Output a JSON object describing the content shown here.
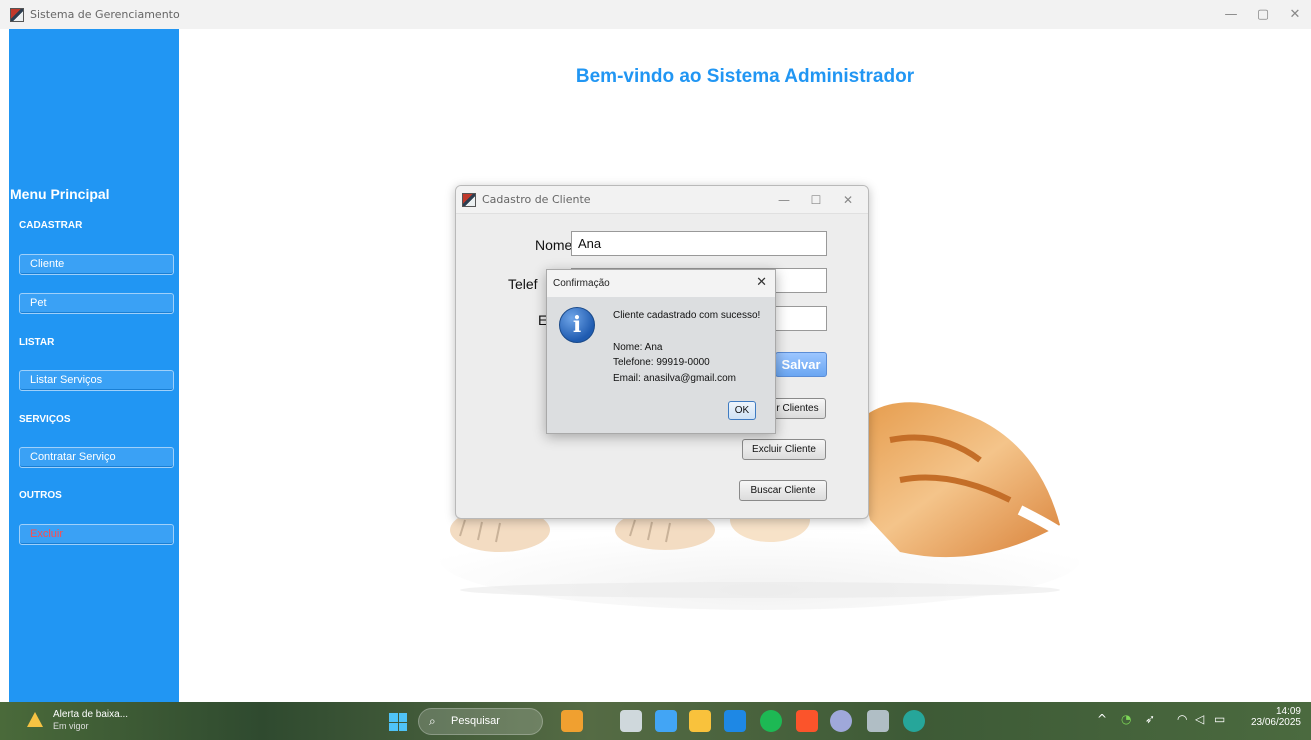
{
  "window": {
    "title": "Sistema de Gerenciamento",
    "minimize": "—",
    "maximize": "▢",
    "close": "✕"
  },
  "sidebar": {
    "menu_title": "Menu Principal",
    "sections": [
      {
        "label": "CADASTRAR",
        "buttons": [
          "Cliente",
          "Pet"
        ]
      },
      {
        "label": "LISTAR",
        "buttons": [
          "Listar Serviços"
        ]
      },
      {
        "label": "SERVIÇOS",
        "buttons": [
          "Contratar Serviço"
        ]
      },
      {
        "label": "OUTROS",
        "buttons": [
          "Excluir"
        ]
      }
    ]
  },
  "main": {
    "welcome": "Bem-vindo ao Sistema Administrador"
  },
  "cadastro": {
    "title": "Cadastro de Cliente",
    "minimize": "—",
    "maximize": "☐",
    "close": "✕",
    "nome_label": "Nome:",
    "nome_value": "Ana",
    "telefone_label": "Telef",
    "email_label": "E",
    "salvar": "Salvar",
    "listar_clientes": "r Clientes",
    "excluir_cliente": "Excluir Cliente",
    "buscar_cliente": "Buscar Cliente"
  },
  "dialog": {
    "title": "Confirmação",
    "close": "✕",
    "icon_glyph": "i",
    "message": "Cliente cadastrado com sucesso!",
    "nome_line": "Nome: Ana",
    "telefone_line": "Telefone: 99919-0000",
    "email_line": "Email: anasilva@gmail.com",
    "ok": "OK"
  },
  "taskbar": {
    "alert_title": "Alerta de baixa...",
    "alert_subtitle": "Em vigor",
    "search_label": "Pesquisar",
    "search_icon": "⌕",
    "time": "14:09",
    "date": "23/06/2025",
    "tray_chevron": "^"
  },
  "colors": {
    "sidebar": "#2196f3",
    "welcome": "#2196f3",
    "excluir_text": "#ff4c4c"
  }
}
